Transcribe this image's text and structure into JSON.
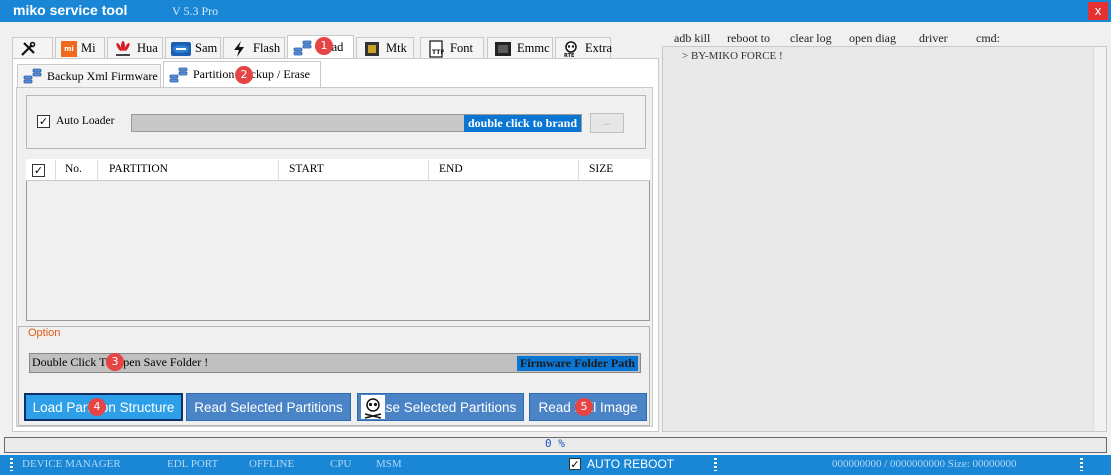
{
  "window": {
    "title": "miko service tool",
    "version": "V 5.3 Pro",
    "close_glyph": "x"
  },
  "main_tabs": [
    {
      "label": "",
      "icon": "tools-icon"
    },
    {
      "label": "Mi",
      "icon": "mi-icon"
    },
    {
      "label": "Hua",
      "icon": "huawei-icon"
    },
    {
      "label": "Sam",
      "icon": "samsung-icon"
    },
    {
      "label": "Flash",
      "icon": "flash-icon"
    },
    {
      "label": "Qcad",
      "icon": "qualcomm-icon"
    },
    {
      "label": "Mtk",
      "icon": "mtk-icon"
    },
    {
      "label": "Font",
      "icon": "font-icon"
    },
    {
      "label": "Emmc",
      "icon": "emmc-icon"
    },
    {
      "label": "Extra",
      "icon": "extra-icon"
    }
  ],
  "sub_tabs": [
    {
      "label": "Backup Xml Firmware"
    },
    {
      "label": "Partition Backup / Erase"
    }
  ],
  "loader": {
    "auto_label": "Auto Loader",
    "auto_checked": true,
    "brand_hint": "double click to brand",
    "browse": "..."
  },
  "table": {
    "columns": [
      "No.",
      "PARTITION",
      "START",
      "END",
      "SIZE"
    ],
    "rows": []
  },
  "option": {
    "label": "Option",
    "folder_hint": "Double Click To Open Save Folder !",
    "folder_path_label": "Firmware Folder Path"
  },
  "actions": [
    {
      "label": "Load Partition Structure"
    },
    {
      "label": "Read Selected Partitions"
    },
    {
      "label": "Erase Selected Partitions"
    },
    {
      "label": "Read Full Image"
    }
  ],
  "badges": [
    "1",
    "2",
    "3",
    "4",
    "5"
  ],
  "right_menu": [
    "adb kill",
    "reboot to",
    "clear log",
    "open diag",
    "driver",
    "cmd:"
  ],
  "log": {
    "lines": [
      "> BY-MIKO FORCE !"
    ]
  },
  "progress": {
    "percent": 0,
    "text": "0 %"
  },
  "status": {
    "device_manager": "DEVICE MANAGER",
    "edl_port": "EDL PORT",
    "state": "OFFLINE",
    "cpu": "CPU",
    "cpu_value": "MSM",
    "auto_reboot_label": "AUTO REBOOT",
    "auto_reboot_checked": true,
    "size_text": "000000000 / 0000000000 Size: 00000000"
  },
  "colors": {
    "accent": "#1a87d6",
    "button": "#4a84c6",
    "badge": "#e64545",
    "option_label": "#e05a10"
  }
}
